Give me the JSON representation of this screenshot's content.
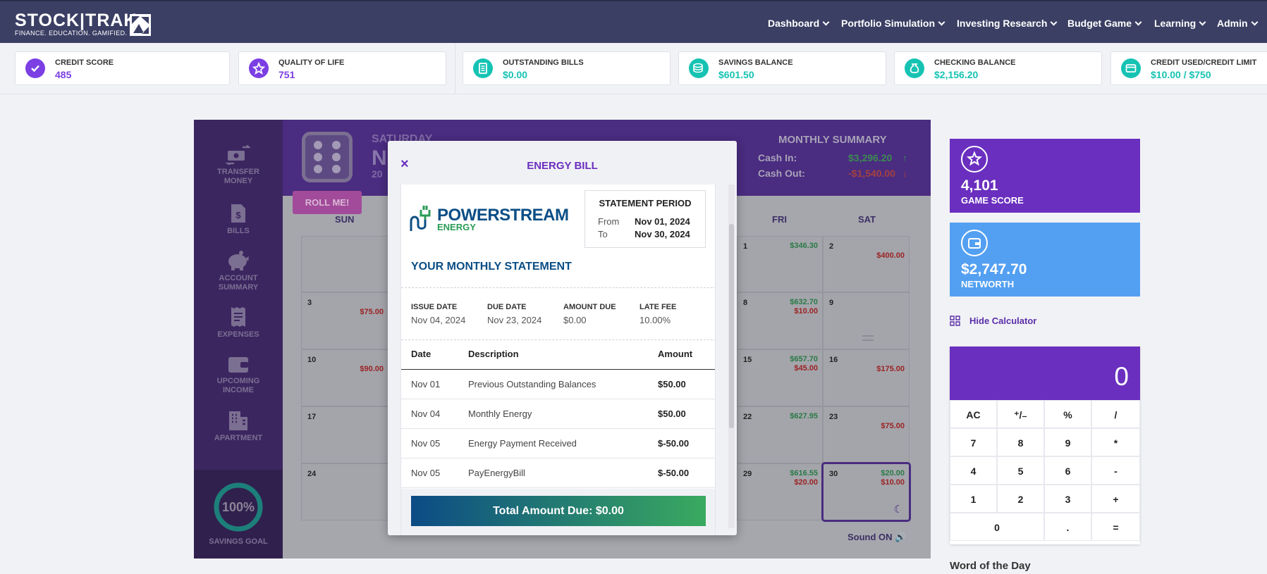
{
  "header": {
    "brand": "STOCK|TRAK",
    "tagline": "FINANCE. EDUCATION. GAMIFIED.",
    "nav": [
      "Dashboard",
      "Portfolio Simulation",
      "Investing Research",
      "Budget Game",
      "Learning",
      "Admin"
    ]
  },
  "stats": [
    {
      "label": "CREDIT SCORE",
      "value": "485",
      "icon": "check-badge-icon",
      "color": "#7b3fe4"
    },
    {
      "label": "QUALITY OF LIFE",
      "value": "751",
      "icon": "star-badge-icon",
      "color": "#7b3fe4"
    },
    {
      "label": "OUTSTANDING BILLS",
      "value": "$0.00",
      "icon": "bill-icon",
      "color": "#16c3b3"
    },
    {
      "label": "SAVINGS BALANCE",
      "value": "$601.50",
      "icon": "coins-icon",
      "color": "#16c3b3"
    },
    {
      "label": "CHECKING BALANCE",
      "value": "$2,156.20",
      "icon": "money-bag-icon",
      "color": "#16c3b3"
    },
    {
      "label": "CREDIT USED/CREDIT LIMIT",
      "value": "$10.00 / $750",
      "icon": "credit-card-icon",
      "color": "#16c3b3"
    }
  ],
  "sidebar": {
    "items": [
      "TRANSFER MONEY",
      "BILLS",
      "ACCOUNT SUMMARY",
      "EXPENSES",
      "UPCOMING INCOME",
      "APARTMENT"
    ],
    "goal_percent": "100%",
    "goal_fraction": 1.0,
    "goal_label": "SAVINGS GOAL"
  },
  "game": {
    "day_label": "SATURDAY",
    "month_partial": "N",
    "year_partial": "20",
    "roll_button": "ROLL ME!",
    "summary_title": "MONTHLY SUMMARY",
    "cash_in_label": "Cash In:",
    "cash_in_value": "$3,296.20",
    "cash_out_label": "Cash Out:",
    "cash_out_value": "-$1,540.00",
    "days_of_week": [
      "SUN",
      "FRI",
      "SAT"
    ],
    "sound_label": "Sound ON",
    "calendar": {
      "sun": [
        {
          "day": "3",
          "amounts": [
            {
              "v": "$75.00",
              "t": "red"
            }
          ]
        },
        {
          "day": "10",
          "amounts": [
            {
              "v": "$90.00",
              "t": "red"
            }
          ]
        },
        {
          "day": "17",
          "amounts": []
        },
        {
          "day": "24",
          "amounts": []
        }
      ],
      "fri": [
        {
          "day": "1",
          "amounts": [
            {
              "v": "$346.30",
              "t": "green"
            }
          ]
        },
        {
          "day": "8",
          "amounts": [
            {
              "v": "$632.70",
              "t": "green"
            },
            {
              "v": "$10.00",
              "t": "red"
            }
          ]
        },
        {
          "day": "15",
          "amounts": [
            {
              "v": "$657.70",
              "t": "green"
            },
            {
              "v": "$45.00",
              "t": "red"
            }
          ]
        },
        {
          "day": "22",
          "amounts": [
            {
              "v": "$627.95",
              "t": "green"
            }
          ]
        },
        {
          "day": "29",
          "amounts": [
            {
              "v": "$616.55",
              "t": "green"
            },
            {
              "v": "$20.00",
              "t": "red"
            }
          ]
        }
      ],
      "sat": [
        {
          "day": "2",
          "amounts": [
            {
              "v": "$400.00",
              "t": "red"
            }
          ]
        },
        {
          "day": "9",
          "amounts": []
        },
        {
          "day": "16",
          "amounts": [
            {
              "v": "$175.00",
              "t": "red"
            }
          ]
        },
        {
          "day": "23",
          "amounts": [
            {
              "v": "$75.00",
              "t": "red"
            }
          ]
        },
        {
          "day": "30",
          "amounts": [
            {
              "v": "$20.00",
              "t": "green"
            },
            {
              "v": "$10.00",
              "t": "red"
            }
          ]
        }
      ]
    }
  },
  "right": {
    "score_value": "4,101",
    "score_label": "GAME SCORE",
    "networth_value": "$2,747.70",
    "networth_label": "NETWORTH",
    "hide_calc": "Hide Calculator",
    "word_of_day": "Word of the Day"
  },
  "calculator": {
    "display": "0",
    "keys": [
      "AC",
      "⁺/₋",
      "%",
      "/",
      "7",
      "8",
      "9",
      "*",
      "4",
      "5",
      "6",
      "-",
      "1",
      "2",
      "3",
      "+",
      "0",
      ".",
      "="
    ]
  },
  "modal": {
    "close": "×",
    "title": "ENERGY BILL",
    "company_line1": "POWERSTREAM",
    "company_line2": "ENERGY",
    "period_title": "STATEMENT PERIOD",
    "from_label": "From",
    "from_value": "Nov 01, 2024",
    "to_label": "To",
    "to_value": "Nov 30, 2024",
    "heading": "YOUR MONTHLY STATEMENT",
    "issue_label": "ISSUE DATE",
    "issue_value": "Nov 04, 2024",
    "due_label": "DUE DATE",
    "due_value": "Nov 23, 2024",
    "amount_due_label": "AMOUNT DUE",
    "amount_due_value": "$0.00",
    "late_label": "LATE FEE",
    "late_value": "10.00%",
    "columns": [
      "Date",
      "Description",
      "Amount"
    ],
    "rows": [
      {
        "date": "Nov 01",
        "desc": "Previous Outstanding Balances",
        "amount": "$50.00"
      },
      {
        "date": "Nov 04",
        "desc": "Monthly Energy",
        "amount": "$50.00"
      },
      {
        "date": "Nov 05",
        "desc": "Energy Payment Received",
        "amount": "$-50.00"
      },
      {
        "date": "Nov 05",
        "desc": "PayEnergyBill",
        "amount": "$-50.00"
      }
    ],
    "total": "Total Amount Due: $0.00"
  }
}
